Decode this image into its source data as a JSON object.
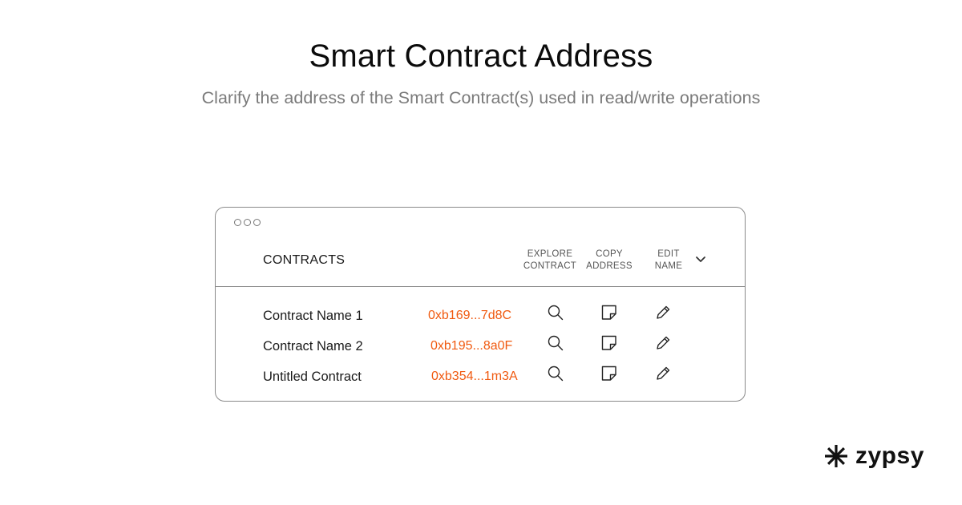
{
  "page": {
    "title": "Smart Contract Address",
    "subtitle": "Clarify the address of the Smart Contract(s) used in read/write operations"
  },
  "window": {
    "header_title": "CONTRACTS",
    "columns": [
      {
        "label": "EXPLORE\nCONTRACT"
      },
      {
        "label": "COPY\nADDRESS"
      },
      {
        "label": "EDIT\nNAME"
      }
    ],
    "rows": [
      {
        "name": "Contract Name 1",
        "address": "0xb169...7d8C"
      },
      {
        "name": "Contract Name 2",
        "address": "0xb195...8a0F"
      },
      {
        "name": "Untitled Contract",
        "address": "0xb354...1m3A"
      }
    ],
    "icons": {
      "explore": "search-icon",
      "copy": "note-icon",
      "edit": "pencil-icon",
      "expand": "chevron-down-icon",
      "window_controls": "window-dots-icon"
    }
  },
  "brand": {
    "name": "zypsy",
    "icon": "asterisk-logo-icon"
  },
  "colors": {
    "address": "#f05a10",
    "border": "#8a8a8a",
    "subtitle": "#7a7a7a"
  }
}
